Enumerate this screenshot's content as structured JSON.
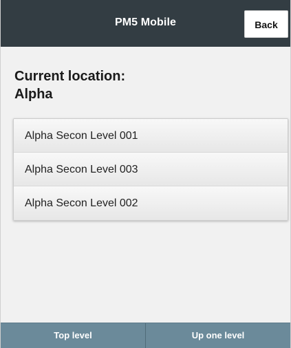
{
  "header": {
    "title": "PM5 Mobile",
    "back_label": "Back"
  },
  "location": {
    "label": "Current location:",
    "value": "Alpha"
  },
  "items": [
    {
      "label": "Alpha Secon Level 001"
    },
    {
      "label": "Alpha Secon Level 003"
    },
    {
      "label": "Alpha Secon Level 002"
    }
  ],
  "footer": {
    "top_level_label": "Top level",
    "up_one_level_label": "Up one level"
  },
  "colors": {
    "header_bg": "#333d43",
    "footer_bg": "#6b8a9a"
  }
}
